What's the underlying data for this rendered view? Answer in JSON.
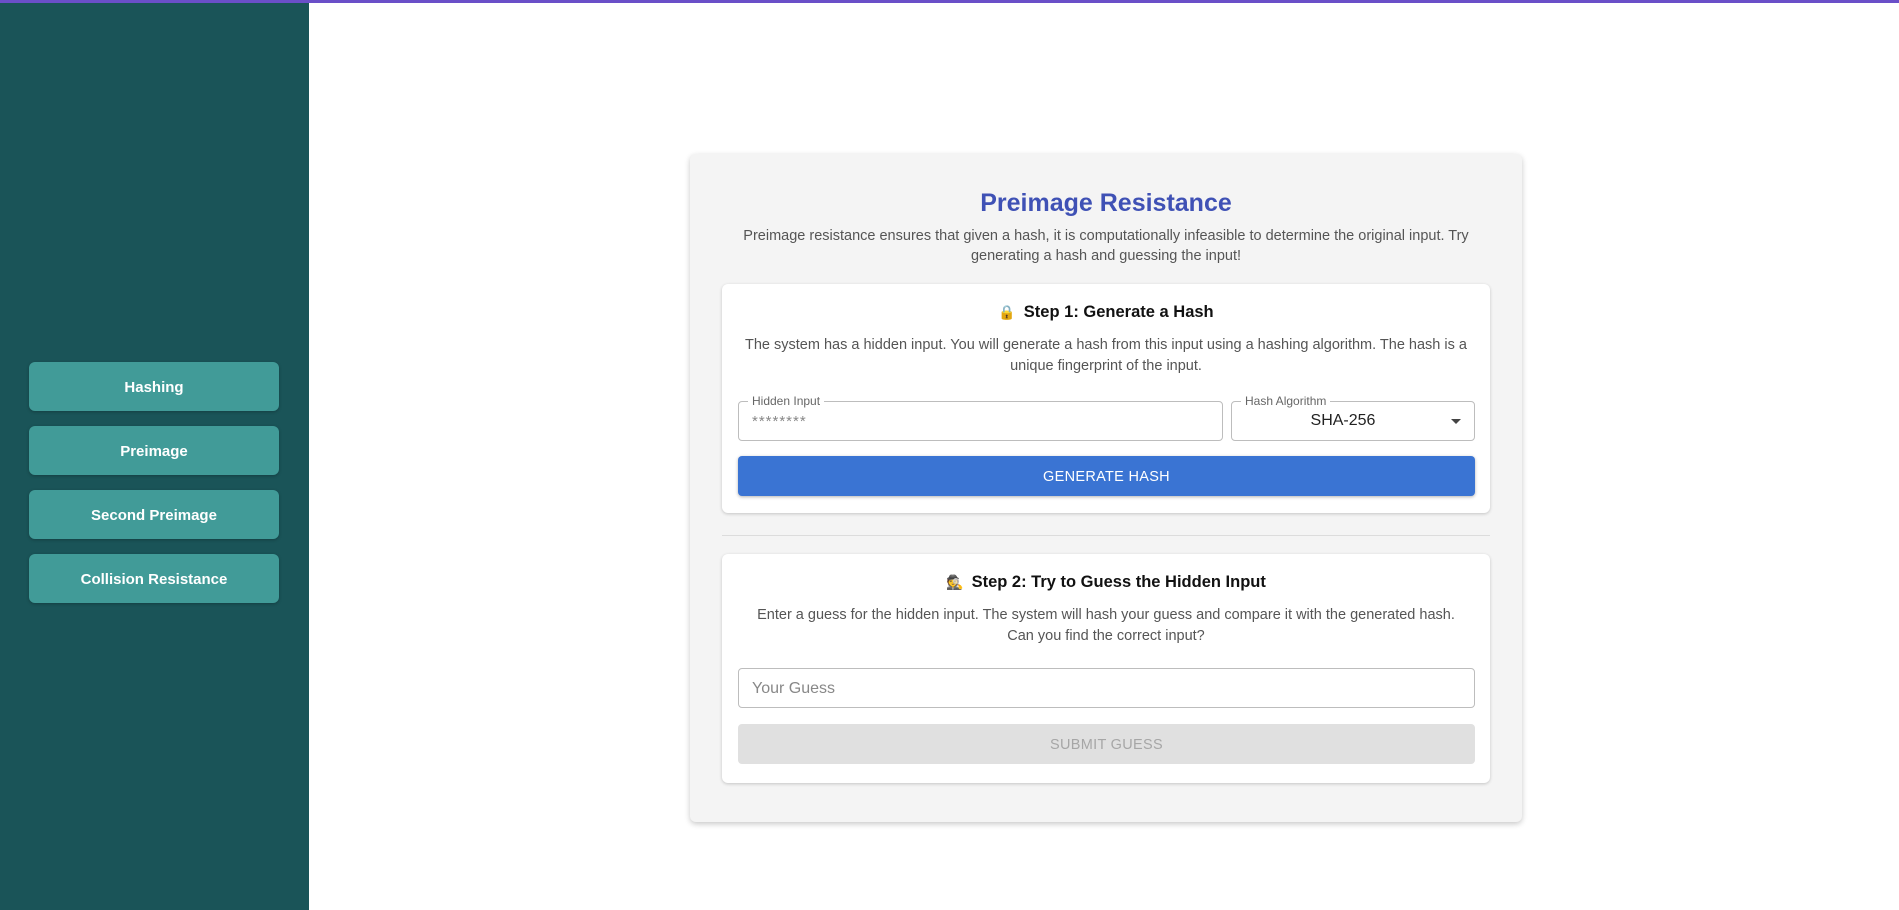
{
  "sidebar": {
    "items": [
      {
        "label": "Hashing"
      },
      {
        "label": "Preimage"
      },
      {
        "label": "Second Preimage"
      },
      {
        "label": "Collision Resistance"
      }
    ]
  },
  "main": {
    "title": "Preimage Resistance",
    "description": "Preimage resistance ensures that given a hash, it is computationally infeasible to determine the original input. Try generating a hash and guessing the input!",
    "step1": {
      "icon": "🔒",
      "icon_name": "lock-icon",
      "heading": "Step 1: Generate a Hash",
      "text": "The system has a hidden input. You will generate a hash from this input using a hashing algorithm. The hash is a unique fingerprint of the input.",
      "hidden_input_label": "Hidden Input",
      "hidden_input_value": "********",
      "algorithm_label": "Hash Algorithm",
      "algorithm_value": "SHA-256",
      "generate_label": "GENERATE HASH"
    },
    "step2": {
      "icon": "🕵",
      "icon_name": "detective-icon",
      "heading": "Step 2: Try to Guess the Hidden Input",
      "text": "Enter a guess for the hidden input. The system will hash your guess and compare it with the generated hash. Can you find the correct input?",
      "guess_placeholder": "Your Guess",
      "submit_label": "SUBMIT GUESS"
    }
  },
  "colors": {
    "sidebar_bg": "#1a5458",
    "nav_button": "#419b98",
    "title": "#3f51b5",
    "primary_button": "#3a74d3",
    "disabled_button": "#e0e0e0"
  }
}
